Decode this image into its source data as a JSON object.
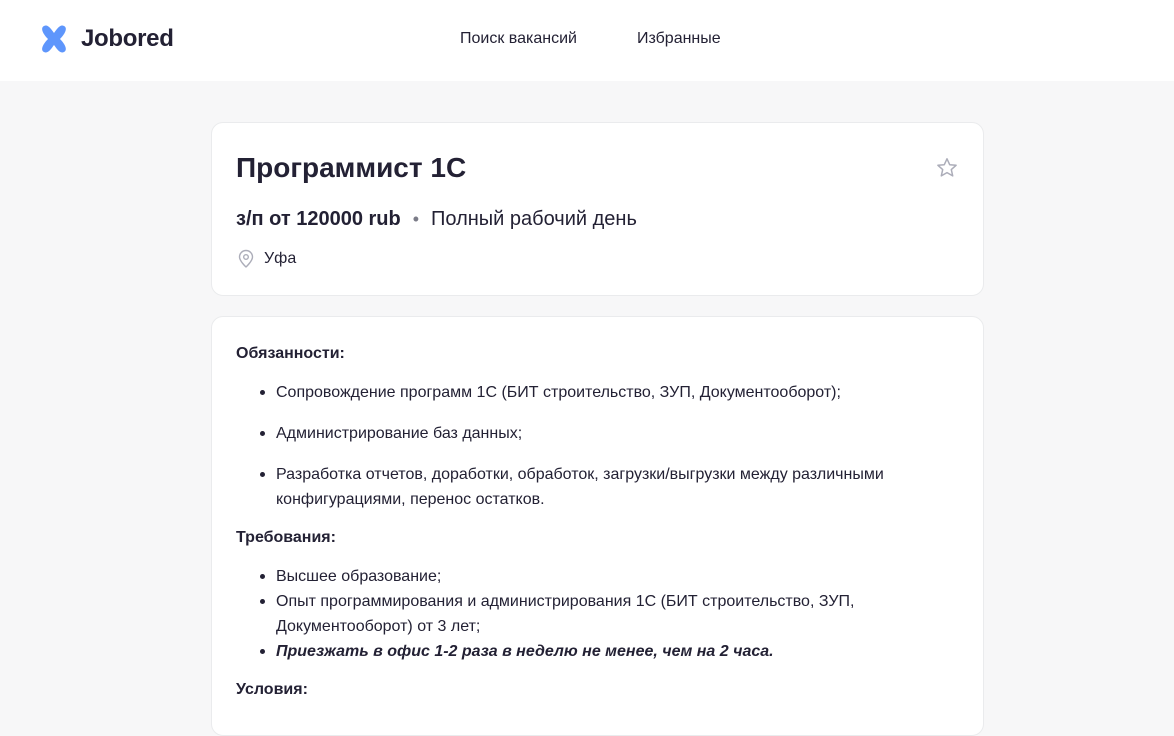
{
  "header": {
    "brand": "Jobored",
    "nav": [
      {
        "label": "Поиск вакансий"
      },
      {
        "label": "Избранные"
      }
    ]
  },
  "vacancy": {
    "title": "Программист 1С",
    "salary": "з/п от 120000 rub",
    "separator": "•",
    "work_type": "Полный рабочий день",
    "location": "Уфа",
    "favorite": false
  },
  "description": {
    "duties_title": "Обязанности:",
    "duties": [
      "Сопровождение программ 1С (БИТ строительство, ЗУП, Документооборот);",
      "Администрирование баз данных;",
      "Разработка отчетов, доработки, обработок, загрузки/выгрузки между различными конфигурациями, перенос остатков."
    ],
    "requirements_title": "Требования:",
    "requirements": [
      "Высшее образование;",
      "Опыт программирования и администрирования 1С (БИТ строительство, ЗУП, Документооборот) от 3 лет;",
      "Приезжать в офис 1-2 раза в неделю не менее, чем на 2 часа."
    ],
    "conditions_title": "Условия:"
  },
  "colors": {
    "brand": "#5e96fc",
    "text": "#232134",
    "muted": "#acadb9",
    "background": "#f7f7f8"
  }
}
